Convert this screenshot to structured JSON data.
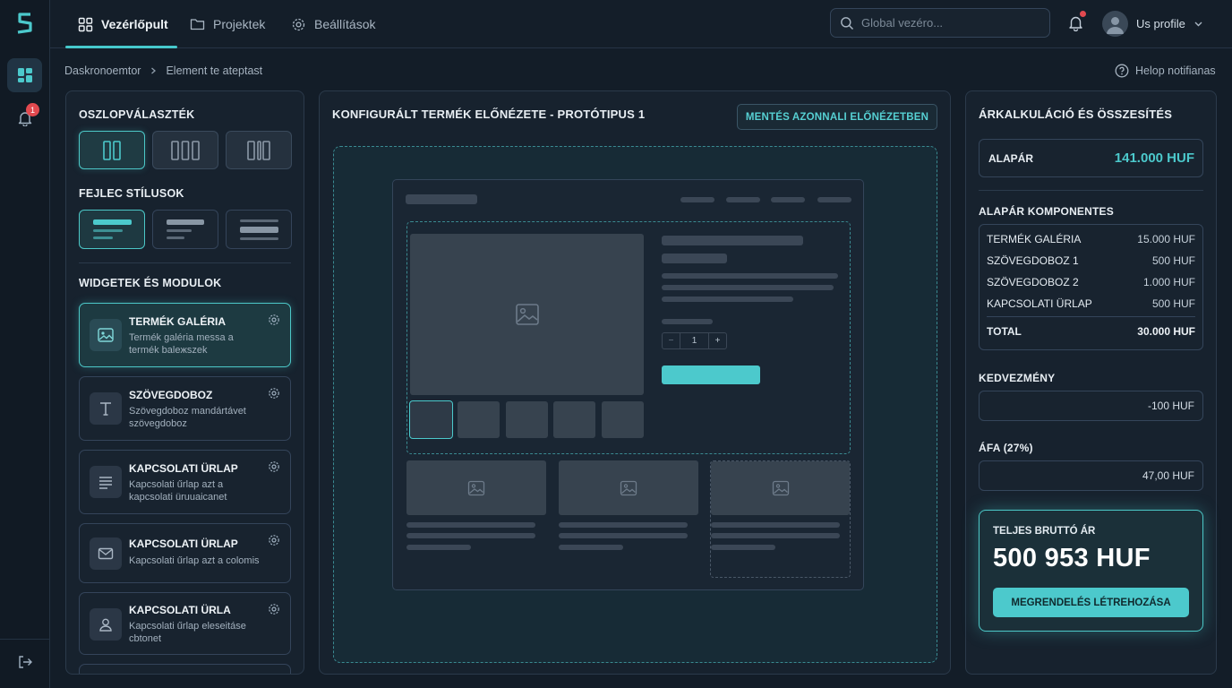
{
  "nav": {
    "tabs": [
      {
        "label": "Vezérlőpult"
      },
      {
        "label": "Projektek"
      },
      {
        "label": "Beállítások"
      }
    ],
    "search_placeholder": "Global vezéro...",
    "notification_count": "1",
    "profile_label": "Us profile"
  },
  "breadcrumb": {
    "items": [
      "Daskronoemtor",
      "Element te ateptast"
    ],
    "help": "Helop notifianas"
  },
  "left": {
    "columns_title": "OSZLOPVÁLASZTÉK",
    "header_title": "FEJLEC STÍLUSOK",
    "widgets_title": "WIDGETEK ÉS MODULOK",
    "widgets": [
      {
        "title": "TERMÉK GALÉRIA",
        "desc": "Termék galéria messa a termék baleжszek",
        "icon": "image-icon"
      },
      {
        "title": "SZÖVEGDOBOZ",
        "desc": "Szövegdoboz mandártávet szövegdoboz",
        "icon": "text-icon"
      },
      {
        "title": "KAPCSOLATI ÜRLAP",
        "desc": "Kapcsolati űrlap azt a kapcsolati üruuaicanet",
        "icon": "form-icon"
      },
      {
        "title": "KAPCSOLATI ÜRLAP",
        "desc": "Kapcsolati űrlap azt a colomis",
        "icon": "mail-icon"
      },
      {
        "title": "KAPCSOLATI ÜRLA",
        "desc": "Kapcsolati űrlap eleseitáse cbtonet",
        "icon": "user-icon"
      }
    ]
  },
  "center": {
    "title": "KONFIGURÁLT TERMÉK ELŐNÉZETE - PROTÓTIPUS 1",
    "save_label": "MENTÉS AZONNALI ELŐNÉZETBEN",
    "quantity": "1",
    "qty_minus": "−",
    "qty_plus": "+"
  },
  "right": {
    "title": "ÁRKALKULÁCIÓ ÉS ÖSSZESÍTÉS",
    "base_label": "ALAPÁR",
    "base_value": "141.000 HUF",
    "components_title": "ALAPÁR KOMPONENTES",
    "components": [
      {
        "name": "TERMÉK GALÉRIA",
        "value": "15.000 HUF"
      },
      {
        "name": "SZÖVEGDOBOZ 1",
        "value": "500 HUF"
      },
      {
        "name": "SZÖVEGDOBOZ 2",
        "value": "1.000 HUF"
      },
      {
        "name": "KAPCSOLATI ÜRLAP",
        "value": "500 HUF"
      }
    ],
    "total_label": "TOTAL",
    "total_value": "30.000 HUF",
    "discount_label": "KEDVEZMÉNY",
    "discount_value": "-100 HUF",
    "vat_label": "ÁFA (27%)",
    "vat_value": "47,00 HUF",
    "gross_label": "TELJES BRUTTÓ ÁR",
    "gross_value": "500 953 HUF",
    "order_label": "MEGRENDELÉS LÉTREHOZÁSA"
  },
  "colors": {
    "accent": "#4cc9cc",
    "background": "#131d28",
    "panel": "#17222e",
    "alert": "#e2494f"
  }
}
